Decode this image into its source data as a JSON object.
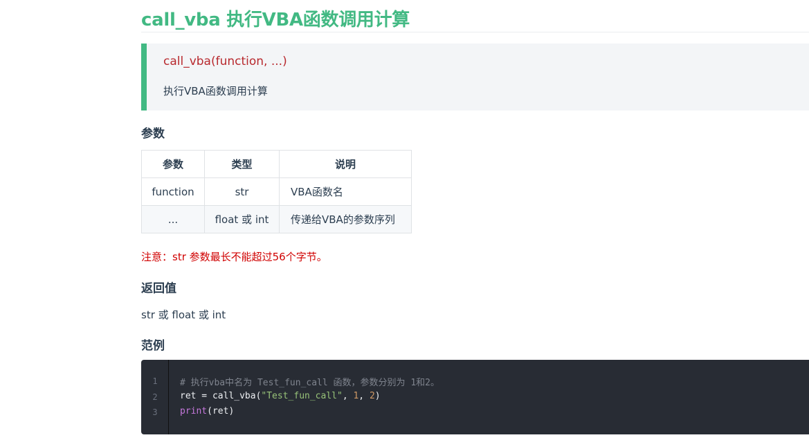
{
  "header": {
    "title": "call_vba 执行VBA函数调用计算"
  },
  "callout": {
    "signature": "call_vba(function, ...)",
    "description": "执行VBA函数调用计算"
  },
  "sections": {
    "params": "参数",
    "returns": "返回值",
    "example": "范例"
  },
  "table": {
    "headers": [
      "参数",
      "类型",
      "说明"
    ],
    "rows": [
      [
        "function",
        "str",
        "VBA函数名"
      ],
      [
        "...",
        "float 或 int",
        "传递给VBA的参数序列"
      ]
    ]
  },
  "note": "注意：str 参数最长不能超过56个字节。",
  "returns_text": "str 或 float 或 int",
  "code": {
    "line_numbers": [
      "1",
      "2",
      "3"
    ],
    "line1_comment": "# 执行vba中名为 Test_fun_call 函数，参数分别为 1和2。",
    "line2_var": "ret = call_vba(",
    "line2_str": "\"Test_fun_call\"",
    "line2_sep1": ", ",
    "line2_num1": "1",
    "line2_sep2": ", ",
    "line2_num2": "2",
    "line2_close": ")",
    "line3_fn": "print",
    "line3_args": "(ret)"
  },
  "colors": {
    "accent": "#42b983",
    "signature": "#b8292e",
    "note": "#d00000",
    "code_bg": "#282c34"
  }
}
